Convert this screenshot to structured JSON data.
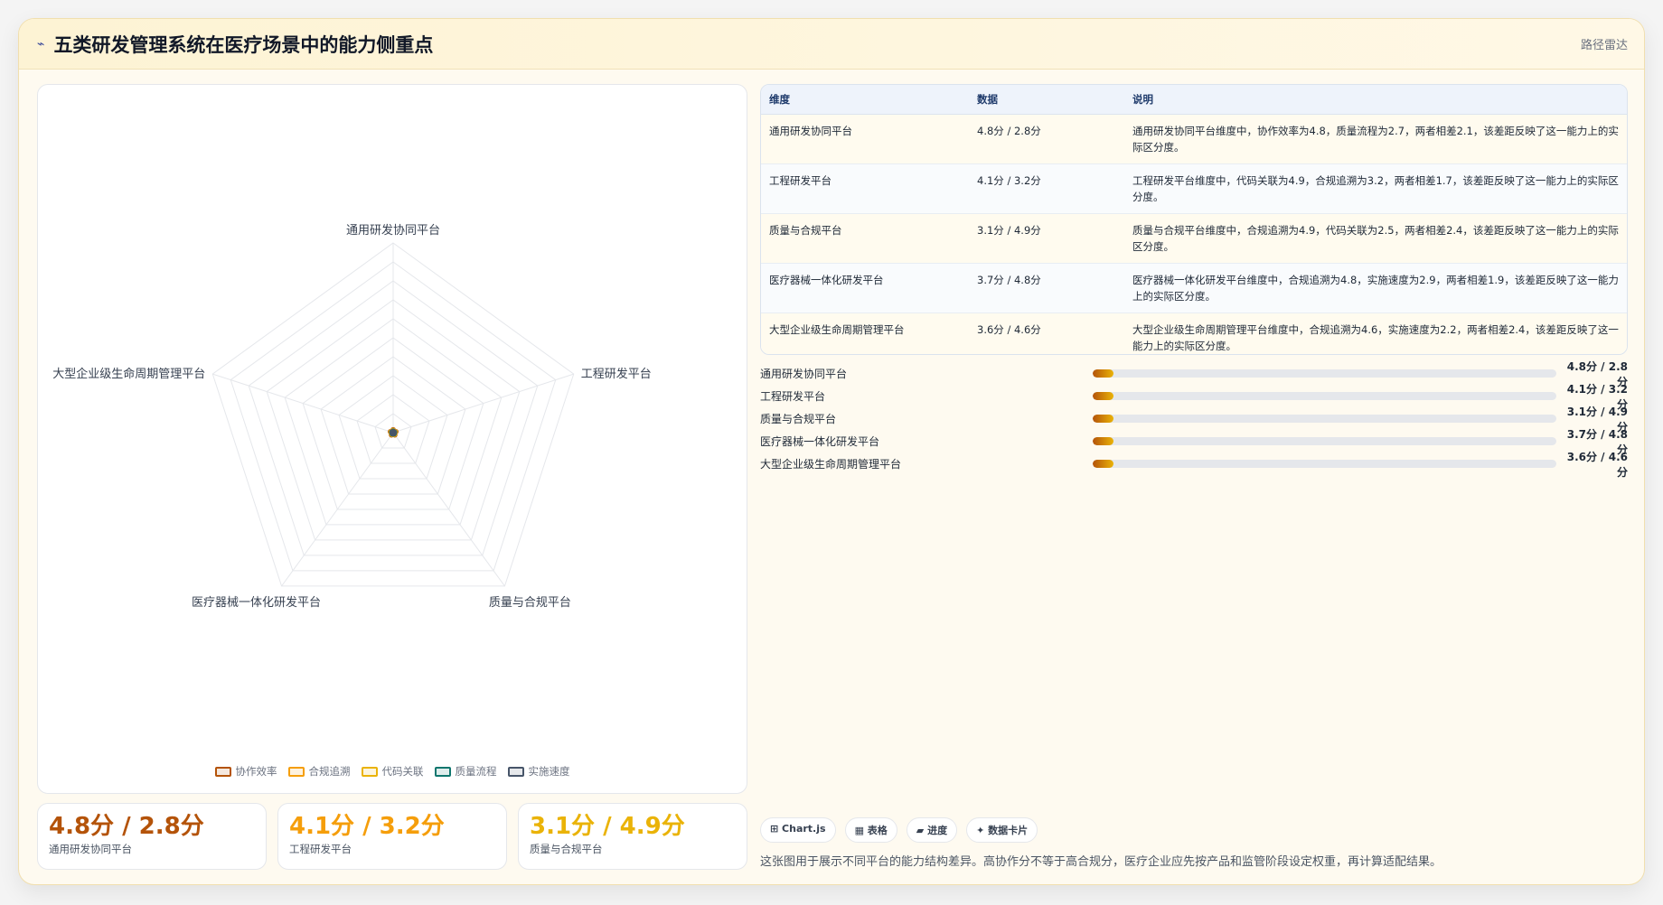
{
  "header": {
    "icon": "trend-icon",
    "title": "五类研发管理系统在医疗场景中的能力侧重点",
    "tag": "路径雷达"
  },
  "chart_data": {
    "type": "radar",
    "axes": [
      "通用研发协同平台",
      "工程研发平台",
      "质量与合规平台",
      "医疗器械一体化研发平台",
      "大型企业级生命周期管理平台"
    ],
    "series": [
      {
        "name": "协作效率",
        "color": "#b45309",
        "values": [
          0.15,
          0.15,
          0.15,
          0.15,
          0.15
        ]
      },
      {
        "name": "合规追溯",
        "color": "#f59e0b",
        "values": [
          0.12,
          0.12,
          0.12,
          0.12,
          0.12
        ]
      },
      {
        "name": "代码关联",
        "color": "#eab308",
        "values": [
          0.1,
          0.1,
          0.1,
          0.1,
          0.1
        ]
      },
      {
        "name": "质量流程",
        "color": "#0f766e",
        "values": [
          0.08,
          0.08,
          0.08,
          0.08,
          0.08
        ]
      },
      {
        "name": "实施速度",
        "color": "#475569",
        "values": [
          0.06,
          0.06,
          0.06,
          0.06,
          0.06
        ]
      }
    ],
    "rlim": [
      0,
      10
    ],
    "grid": true,
    "legend": "bottom"
  },
  "legend": [
    {
      "name": "协作效率",
      "color": "#b45309"
    },
    {
      "name": "合规追溯",
      "color": "#f59e0b"
    },
    {
      "name": "代码关联",
      "color": "#eab308"
    },
    {
      "name": "质量流程",
      "color": "#0f766e"
    },
    {
      "name": "实施速度",
      "color": "#475569"
    }
  ],
  "stats": [
    {
      "value": "4.8分 / 2.8分",
      "label": "通用研发协同平台",
      "color": "#b45309"
    },
    {
      "value": "4.1分 / 3.2分",
      "label": "工程研发平台",
      "color": "#f59e0b"
    },
    {
      "value": "3.1分 / 4.9分",
      "label": "质量与合规平台",
      "color": "#eab308"
    }
  ],
  "table": {
    "headers": [
      "维度",
      "数据",
      "说明"
    ],
    "rows": [
      {
        "dim": "通用研发协同平台",
        "data": "4.8分 / 2.8分",
        "desc": "通用研发协同平台维度中，协作效率为4.8，质量流程为2.7，两者相差2.1，该差距反映了这一能力上的实际区分度。"
      },
      {
        "dim": "工程研发平台",
        "data": "4.1分 / 3.2分",
        "desc": "工程研发平台维度中，代码关联为4.9，合规追溯为3.2，两者相差1.7，该差距反映了这一能力上的实际区分度。"
      },
      {
        "dim": "质量与合规平台",
        "data": "3.1分 / 4.9分",
        "desc": "质量与合规平台维度中，合规追溯为4.9，代码关联为2.5，两者相差2.4，该差距反映了这一能力上的实际区分度。"
      },
      {
        "dim": "医疗器械一体化研发平台",
        "data": "3.7分 / 4.8分",
        "desc": "医疗器械一体化研发平台维度中，合规追溯为4.8，实施速度为2.9，两者相差1.9，该差距反映了这一能力上的实际区分度。"
      },
      {
        "dim": "大型企业级生命周期管理平台",
        "data": "3.6分 / 4.6分",
        "desc": "大型企业级生命周期管理平台维度中，合规追溯为4.6，实施速度为2.2，两者相差2.4，该差距反映了这一能力上的实际区分度。"
      }
    ]
  },
  "bars": [
    {
      "label": "通用研发协同平台",
      "value": "4.8分 / 2.8分",
      "fill": 0.045
    },
    {
      "label": "工程研发平台",
      "value": "4.1分 / 3.2分",
      "fill": 0.045
    },
    {
      "label": "质量与合规平台",
      "value": "3.1分 / 4.9分",
      "fill": 0.045
    },
    {
      "label": "医疗器械一体化研发平台",
      "value": "3.7分 / 4.8分",
      "fill": 0.045
    },
    {
      "label": "大型企业级生命周期管理平台",
      "value": "3.6分 / 4.6分",
      "fill": 0.045
    }
  ],
  "chips": [
    "⊞ Chart.js",
    "▦ 表格",
    "▰ 进度",
    "✦ 数据卡片"
  ],
  "note": "这张图用于展示不同平台的能力结构差异。高协作分不等于高合规分，医疗企业应先按产品和监管阶段设定权重，再计算适配结果。"
}
